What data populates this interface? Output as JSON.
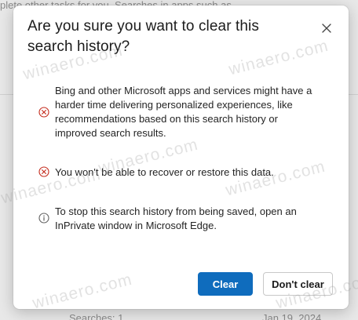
{
  "background": {
    "top_text": "plete other tasks for you. Searches in apps such as",
    "bottom_left_text": "Searches: 1",
    "bottom_right_text": "Jan 19, 2024"
  },
  "dialog": {
    "title": "Are you sure you want to clear this search history?",
    "close_icon": "close-icon",
    "items": [
      {
        "icon": "error-circle-icon",
        "text": "Bing and other Microsoft apps and services might have a harder time delivering personalized experiences, like recommendations based on this search history or improved search results."
      },
      {
        "icon": "error-circle-icon",
        "text": "You won't be able to recover or restore this data."
      },
      {
        "icon": "info-circle-icon",
        "text": "To stop this search history from being saved, open an InPrivate window in Microsoft Edge."
      }
    ],
    "buttons": {
      "clear": "Clear",
      "dont_clear": "Don't clear"
    }
  },
  "watermark": "winaero.com",
  "colors": {
    "accent": "#0f6cbd",
    "error_icon": "#c42b1c",
    "info_icon": "#616161"
  }
}
